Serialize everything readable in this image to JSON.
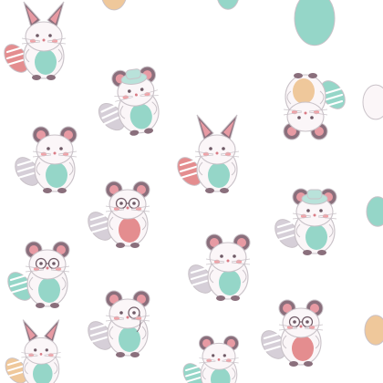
{
  "pattern": {
    "background": "#ffffff",
    "colors": {
      "body": "#fbf6f8",
      "outline": "#c9c2c8",
      "ear_dark": "#8a6f7c",
      "ear_pink": "#e79aa3",
      "mint": "#95d6c8",
      "coral": "#e48d8f",
      "peach": "#efc89b",
      "lavender": "#d6cfd8",
      "cheek": "#f2a3a8",
      "eye": "#6f5a66",
      "nose": "#d97b85",
      "hat": "#b9e2da"
    },
    "creatures": [
      {
        "id": "c1",
        "variant": "big-ear",
        "accent": "mint",
        "tail": "coral"
      },
      {
        "id": "c2",
        "variant": "hat",
        "accent": "mint",
        "tail": "lavender"
      },
      {
        "id": "c3",
        "variant": "round-ear",
        "accent": "mint",
        "tail": "lavender"
      },
      {
        "id": "c4",
        "variant": "glasses",
        "accent": "coral",
        "tail": "lavender"
      },
      {
        "id": "c5",
        "variant": "big-ear",
        "accent": "mint",
        "tail": "coral"
      },
      {
        "id": "c6",
        "variant": "upside-down",
        "accent": "peach",
        "tail": "mint"
      },
      {
        "id": "c7",
        "variant": "glasses",
        "accent": "mint",
        "tail": "mint"
      },
      {
        "id": "c8",
        "variant": "monocle",
        "accent": "mint",
        "tail": "lavender"
      },
      {
        "id": "c9",
        "variant": "round-ear",
        "accent": "mint",
        "tail": "lavender"
      },
      {
        "id": "c10",
        "variant": "hat",
        "accent": "mint",
        "tail": "lavender"
      },
      {
        "id": "c11",
        "variant": "glasses",
        "accent": "coral",
        "tail": "lavender"
      },
      {
        "id": "c12",
        "variant": "big-ear",
        "accent": "mint",
        "tail": "peach"
      },
      {
        "id": "c13",
        "variant": "round-ear",
        "accent": "mint",
        "tail": "mint"
      }
    ]
  }
}
